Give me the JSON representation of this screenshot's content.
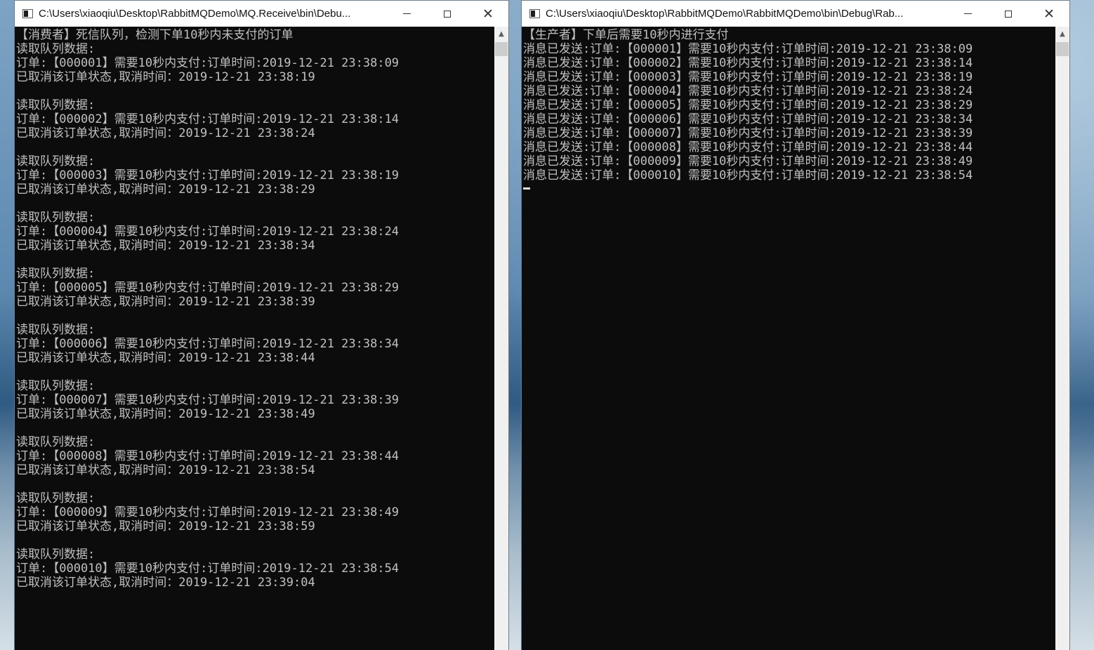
{
  "consumer": {
    "title": "C:\\Users\\xiaoqiu\\Desktop\\RabbitMQDemo\\MQ.Receive\\bin\\Debu...",
    "lines": [
      "【消费者】死信队列，检测下单10秒内未支付的订单",
      "读取队列数据:",
      "订单:【000001】需要10秒内支付:订单时间:2019-12-21 23:38:09",
      "已取消该订单状态,取消时间：2019-12-21 23:38:19",
      "",
      "读取队列数据:",
      "订单:【000002】需要10秒内支付:订单时间:2019-12-21 23:38:14",
      "已取消该订单状态,取消时间：2019-12-21 23:38:24",
      "",
      "读取队列数据:",
      "订单:【000003】需要10秒内支付:订单时间:2019-12-21 23:38:19",
      "已取消该订单状态,取消时间：2019-12-21 23:38:29",
      "",
      "读取队列数据:",
      "订单:【000004】需要10秒内支付:订单时间:2019-12-21 23:38:24",
      "已取消该订单状态,取消时间：2019-12-21 23:38:34",
      "",
      "读取队列数据:",
      "订单:【000005】需要10秒内支付:订单时间:2019-12-21 23:38:29",
      "已取消该订单状态,取消时间：2019-12-21 23:38:39",
      "",
      "读取队列数据:",
      "订单:【000006】需要10秒内支付:订单时间:2019-12-21 23:38:34",
      "已取消该订单状态,取消时间：2019-12-21 23:38:44",
      "",
      "读取队列数据:",
      "订单:【000007】需要10秒内支付:订单时间:2019-12-21 23:38:39",
      "已取消该订单状态,取消时间：2019-12-21 23:38:49",
      "",
      "读取队列数据:",
      "订单:【000008】需要10秒内支付:订单时间:2019-12-21 23:38:44",
      "已取消该订单状态,取消时间：2019-12-21 23:38:54",
      "",
      "读取队列数据:",
      "订单:【000009】需要10秒内支付:订单时间:2019-12-21 23:38:49",
      "已取消该订单状态,取消时间：2019-12-21 23:38:59",
      "",
      "读取队列数据:",
      "订单:【000010】需要10秒内支付:订单时间:2019-12-21 23:38:54",
      "已取消该订单状态,取消时间：2019-12-21 23:39:04"
    ]
  },
  "producer": {
    "title": "C:\\Users\\xiaoqiu\\Desktop\\RabbitMQDemo\\RabbitMQDemo\\bin\\Debug\\Rab...",
    "lines": [
      "【生产者】下单后需要10秒内进行支付",
      "消息已发送:订单:【000001】需要10秒内支付:订单时间:2019-12-21 23:38:09",
      "消息已发送:订单:【000002】需要10秒内支付:订单时间:2019-12-21 23:38:14",
      "消息已发送:订单:【000003】需要10秒内支付:订单时间:2019-12-21 23:38:19",
      "消息已发送:订单:【000004】需要10秒内支付:订单时间:2019-12-21 23:38:24",
      "消息已发送:订单:【000005】需要10秒内支付:订单时间:2019-12-21 23:38:29",
      "消息已发送:订单:【000006】需要10秒内支付:订单时间:2019-12-21 23:38:34",
      "消息已发送:订单:【000007】需要10秒内支付:订单时间:2019-12-21 23:38:39",
      "消息已发送:订单:【000008】需要10秒内支付:订单时间:2019-12-21 23:38:44",
      "消息已发送:订单:【000009】需要10秒内支付:订单时间:2019-12-21 23:38:49",
      "消息已发送:订单:【000010】需要10秒内支付:订单时间:2019-12-21 23:38:54"
    ]
  },
  "window_controls": {
    "close_glyph": "✕",
    "scroll_up_glyph": "▲"
  },
  "icons": {
    "app": "console-app-icon",
    "minimize": "minimize-icon",
    "maximize": "maximize-icon",
    "close": "close-icon",
    "scroll_up": "scroll-up-icon"
  },
  "colors": {
    "console_bg": "#0c0c0c",
    "console_text": "#c0c0c0",
    "titlebar_bg": "#ffffff"
  }
}
